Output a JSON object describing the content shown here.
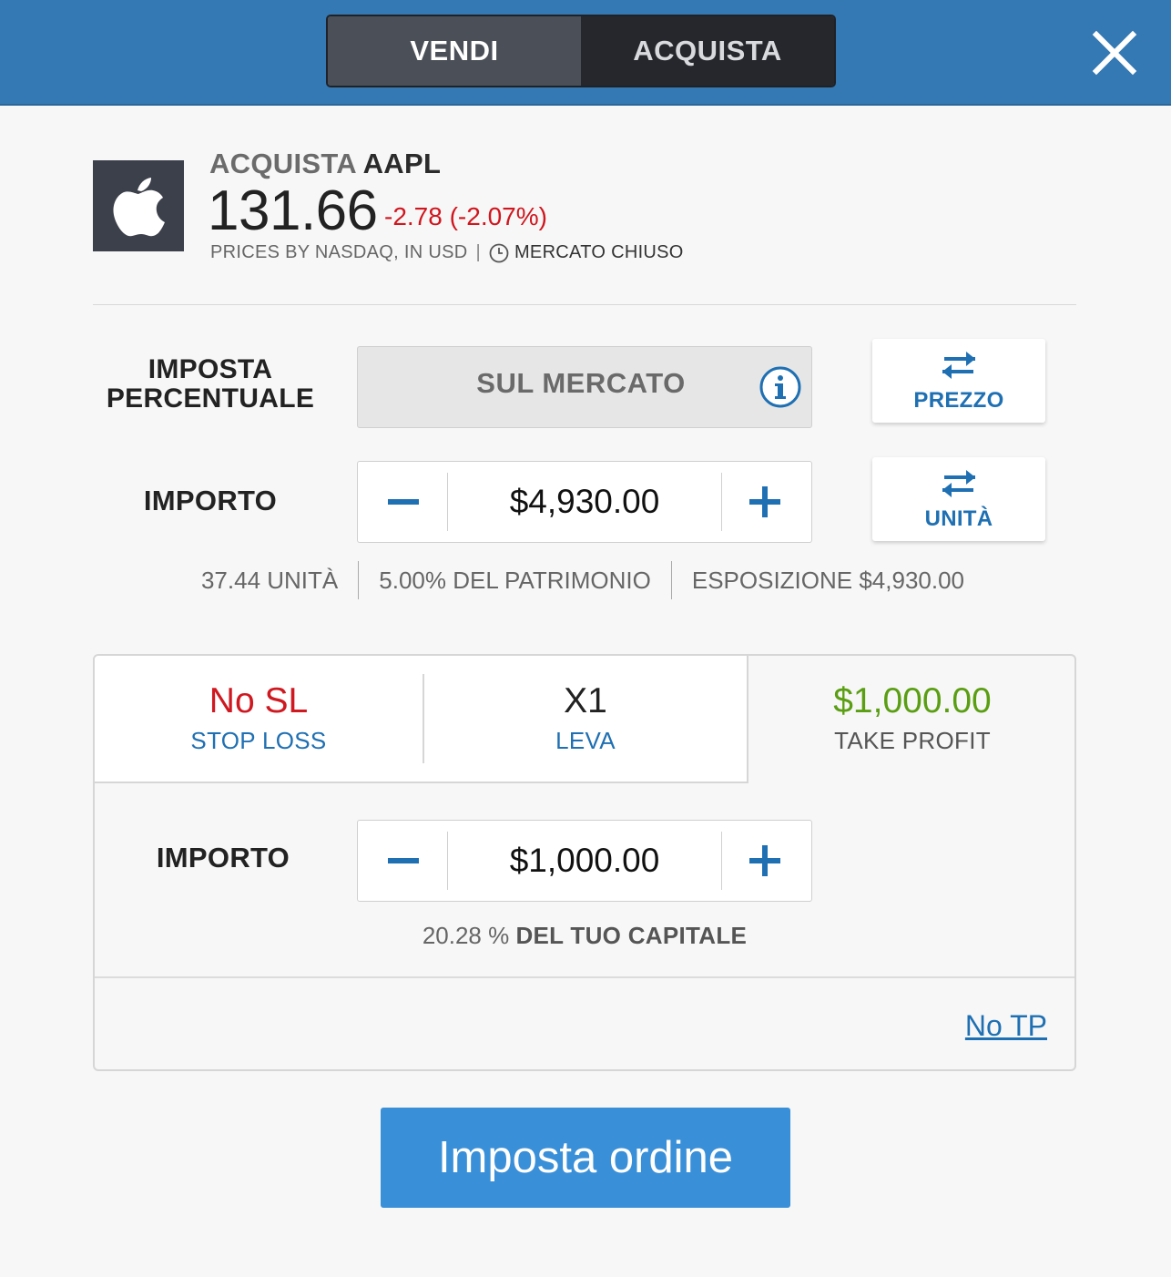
{
  "header": {
    "mode_sell_label": "VENDI",
    "mode_buy_label": "ACQUISTA",
    "active_mode": "VENDI",
    "close_icon": "close-icon"
  },
  "instrument": {
    "logo_icon": "apple-logo-icon",
    "action": "ACQUISTA",
    "ticker": "AAPL",
    "price": "131.66",
    "change": "-2.78 (-2.07%)",
    "source": "PRICES BY NASDAQ, IN USD",
    "separator": "|",
    "market_status": "MERCATO CHIUSO",
    "change_color": "#d0161e"
  },
  "rate": {
    "label_line1": "IMPOSTA",
    "label_line2": "PERCENTUALE",
    "value": "SUL MERCATO",
    "info_icon": "info-icon",
    "switch_label": "PREZZO"
  },
  "amount": {
    "label": "IMPORTO",
    "value": "$4,930.00",
    "switch_label": "UNITÀ"
  },
  "stats": {
    "units": "37.44 UNITÀ",
    "equity": "5.00% DEL PATRIMONIO",
    "exposure": "ESPOSIZIONE $4,930.00"
  },
  "tabs": {
    "stop_loss": {
      "value": "No SL",
      "caption": "STOP LOSS"
    },
    "leverage": {
      "value": "X1",
      "caption": "LEVA"
    },
    "take_profit": {
      "value": "$1,000.00",
      "caption": "TAKE PROFIT"
    }
  },
  "take_profit_panel": {
    "label": "IMPORTO",
    "value": "$1,000.00",
    "capital_percent": "20.28 %",
    "capital_text": "DEL TUO CAPITALE",
    "no_tp_link": "No TP"
  },
  "submit_label": "Imposta ordine",
  "colors": {
    "header_bg": "#3479b3",
    "accent_blue": "#1f70b3",
    "submit_bg": "#3a90d8",
    "loss_red": "#cf1820",
    "profit_green": "#5a9e12"
  }
}
